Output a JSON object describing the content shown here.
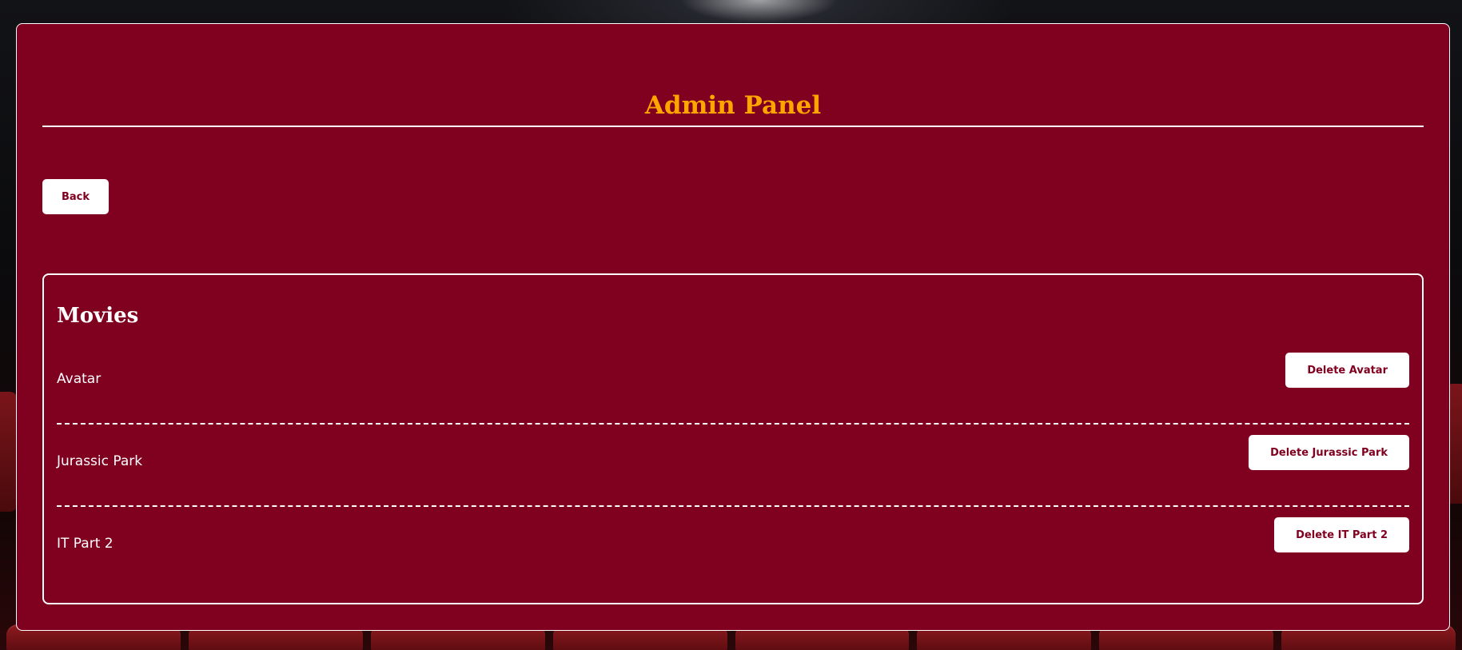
{
  "header": {
    "title": "Admin Panel"
  },
  "toolbar": {
    "back_label": "Back"
  },
  "movies": {
    "heading": "Movies",
    "items": [
      {
        "name": "Avatar",
        "delete_label": "Delete Avatar"
      },
      {
        "name": "Jurassic Park",
        "delete_label": "Delete Jurassic Park"
      },
      {
        "name": "IT Part 2",
        "delete_label": "Delete IT Part 2"
      }
    ]
  },
  "colors": {
    "panel_background": "#800020",
    "title_accent": "#ffa500",
    "button_background": "#ffffff",
    "button_text": "#800020",
    "border": "#ffffff"
  }
}
